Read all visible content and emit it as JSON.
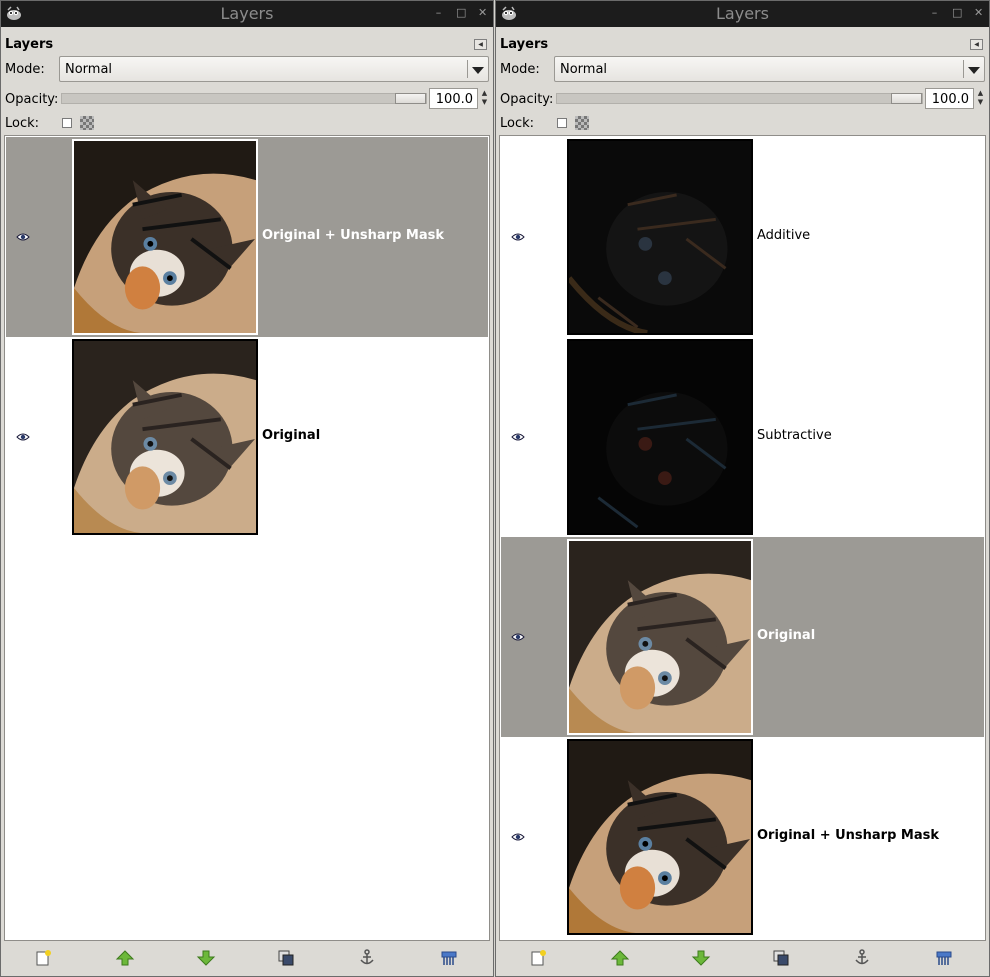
{
  "left": {
    "window_title": "Layers",
    "dock_title": "Layers",
    "mode_label": "Mode:",
    "mode_value": "Normal",
    "opacity_label": "Opacity:",
    "opacity_value": "100.0",
    "lock_label": "Lock:",
    "layers": [
      {
        "name": "Original + Unsharp Mask",
        "selected": true,
        "visible": true,
        "thumbnail": "kitten-sharpened"
      },
      {
        "name": "Original",
        "selected": false,
        "visible": true,
        "thumbnail": "kitten-original"
      }
    ]
  },
  "right": {
    "window_title": "Layers",
    "dock_title": "Layers",
    "mode_label": "Mode:",
    "mode_value": "Normal",
    "opacity_label": "Opacity:",
    "opacity_value": "100.0",
    "lock_label": "Lock:",
    "layers": [
      {
        "name": "Additive",
        "selected": false,
        "visible": true,
        "thumbnail": "kitten-additive-dark"
      },
      {
        "name": "Subtractive",
        "selected": false,
        "visible": true,
        "thumbnail": "kitten-subtractive-dark"
      },
      {
        "name": "Original",
        "selected": true,
        "visible": true,
        "thumbnail": "kitten-original"
      },
      {
        "name": "Original + Unsharp Mask",
        "selected": false,
        "visible": true,
        "thumbnail": "kitten-sharpened"
      }
    ]
  },
  "titlebar_buttons": [
    "minimize-icon",
    "maximize-icon",
    "close-icon"
  ],
  "toolbar_icons": [
    "new-layer-icon",
    "raise-layer-icon",
    "lower-layer-icon",
    "duplicate-layer-icon",
    "anchor-layer-icon",
    "delete-layer-icon"
  ],
  "colors": {
    "titlebar": "#1c1c1c",
    "panel_bg": "#dcdad5",
    "selected_row": "#9c9a95",
    "list_bg": "#ffffff",
    "arrow_green": "#6cb83a"
  }
}
